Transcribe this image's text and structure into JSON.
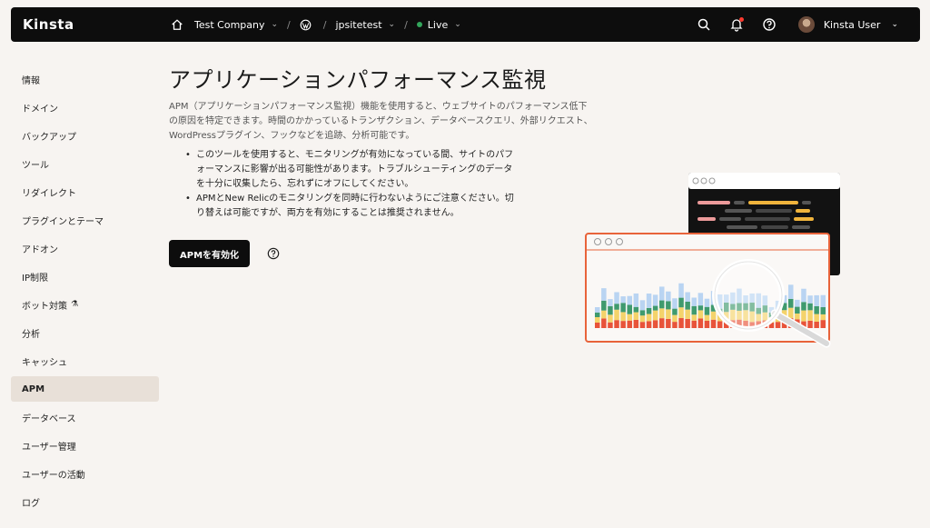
{
  "topbar": {
    "logo": "Kinsta",
    "company": "Test Company",
    "site": "jpsitetest",
    "environment": "Live",
    "user_name": "Kinsta User",
    "separator": "/",
    "live_color": "#33a65c",
    "notification_color": "#ff3a2f"
  },
  "sidebar": {
    "items": [
      {
        "label": "情報"
      },
      {
        "label": "ドメイン"
      },
      {
        "label": "バックアップ"
      },
      {
        "label": "ツール"
      },
      {
        "label": "リダイレクト"
      },
      {
        "label": "プラグインとテーマ"
      },
      {
        "label": "アドオン"
      },
      {
        "label": "IP制限"
      },
      {
        "label": "ボット対策"
      },
      {
        "label": "分析"
      },
      {
        "label": "キャッシュ"
      },
      {
        "label": "APM"
      },
      {
        "label": "データベース"
      },
      {
        "label": "ユーザー管理"
      },
      {
        "label": "ユーザーの活動"
      },
      {
        "label": "ログ"
      }
    ],
    "active": "APM"
  },
  "main": {
    "title": "アプリケーションパフォーマンス監視",
    "description": "APM（アプリケーションパフォーマンス監視）機能を使用すると、ウェブサイトのパフォーマンス低下の原因を特定できます。時間のかかっているトランザクション、データベースクエリ、外部リクエスト、WordPressプラグイン、フックなどを追跡、分析可能です。",
    "bullets": [
      "このツールを使用すると、モニタリングが有効になっている間、サイトのパフォーマンスに影響が出る可能性があります。トラブルシューティングのデータを十分に収集したら、忘れずにオフにしてください。",
      "APMとNew Relicのモニタリングを同時に行わないようにご注意ください。切り替えは可能ですが、両方を有効にすることは推奨されません。"
    ],
    "enable_button": "APMを有効化"
  }
}
